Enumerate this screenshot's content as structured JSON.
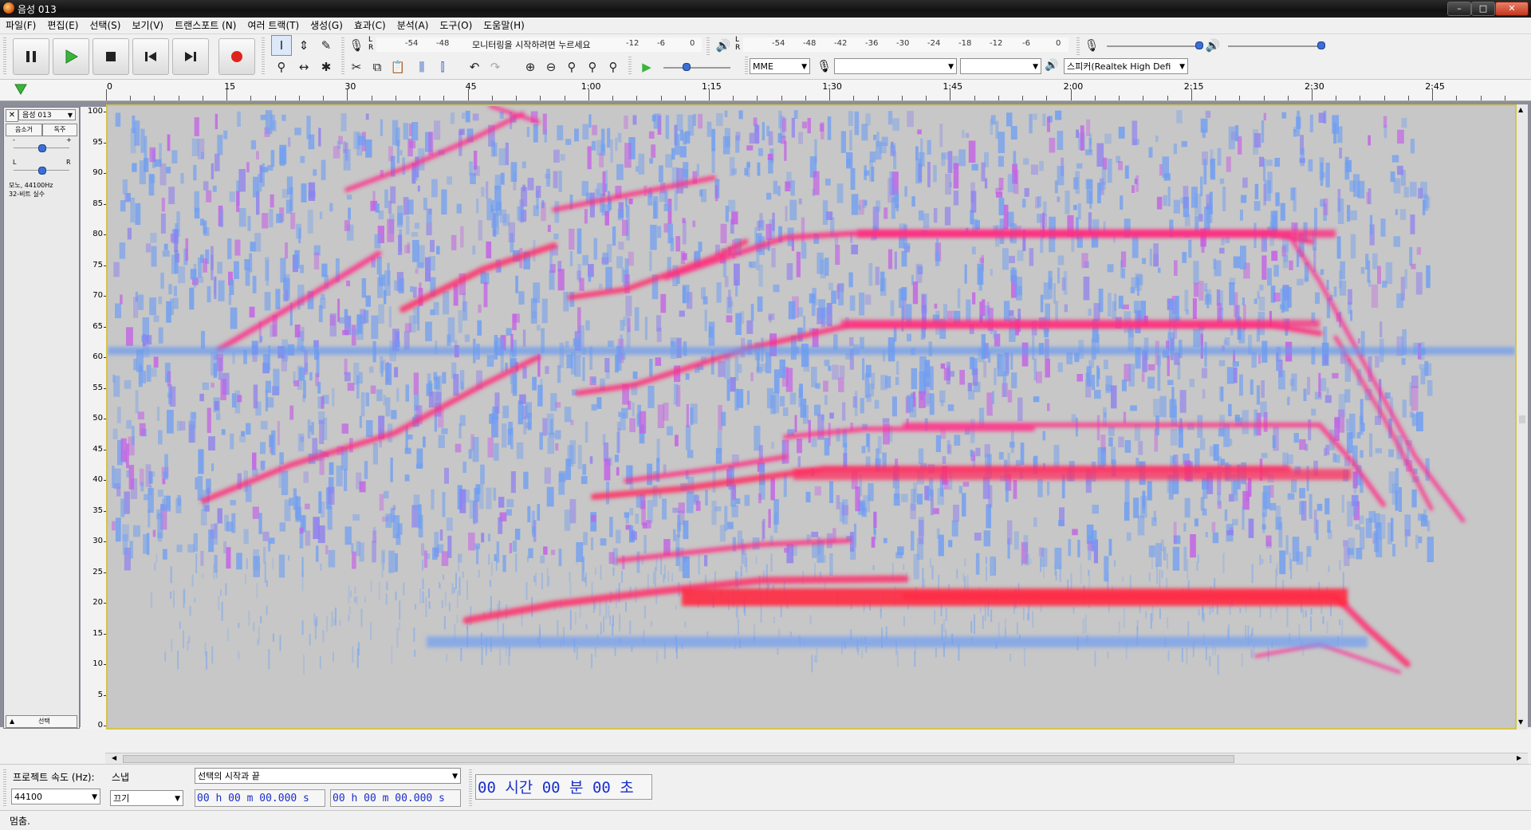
{
  "window": {
    "title": "음성 013"
  },
  "menu": [
    "파일(F)",
    "편집(E)",
    "선택(S)",
    "보기(V)",
    "트랜스포트 (N)",
    "여러 트랙(T)",
    "생성(G)",
    "효과(C)",
    "분석(A)",
    "도구(O)",
    "도움말(H)"
  ],
  "meters": {
    "record_scale": [
      "-54",
      "-48",
      "-12",
      "-6",
      "0"
    ],
    "record_hint": "모니터링을 시작하려면 누르세요",
    "playback_scale": [
      "-54",
      "-48",
      "-42",
      "-36",
      "-30",
      "-24",
      "-18",
      "-12",
      "-6",
      "0"
    ],
    "lr": {
      "l": "L",
      "r": "R"
    }
  },
  "devices": {
    "host": "MME",
    "recording_device": "",
    "recording_channels": "",
    "playback_device": "스피커(Realtek High Defi"
  },
  "ruler": {
    "labels": [
      "0",
      "15",
      "30",
      "45",
      "1:00",
      "1:15",
      "1:30",
      "1:45",
      "2:00",
      "2:15",
      "2:30",
      "2:45"
    ]
  },
  "track": {
    "name": "음성 013",
    "mute": "음소거",
    "solo": "독주",
    "pan_l": "L",
    "pan_r": "R",
    "gain_minus": "-",
    "gain_plus": "+",
    "info": "모노, 44100Hz",
    "format": "32-비트 실수",
    "select": "선택",
    "freq_labels": [
      "100",
      "95",
      "90",
      "85",
      "80",
      "75",
      "70",
      "65",
      "60",
      "55",
      "50",
      "45",
      "40",
      "35",
      "30",
      "25",
      "20",
      "15",
      "10",
      "5",
      "0"
    ]
  },
  "selection_toolbar": {
    "rate_label": "프로젝트 속도 (Hz):",
    "rate_value": "44100",
    "snap_label": "스냅",
    "snap_value": "끄기",
    "mode_value": "선택의 시작과 끝",
    "start_time": "00 h 00 m 00.000 s",
    "end_time": "00 h 00 m 00.000 s",
    "audio_position": "00 시간 00 분 00 초"
  },
  "status": {
    "text": "멈춤."
  }
}
